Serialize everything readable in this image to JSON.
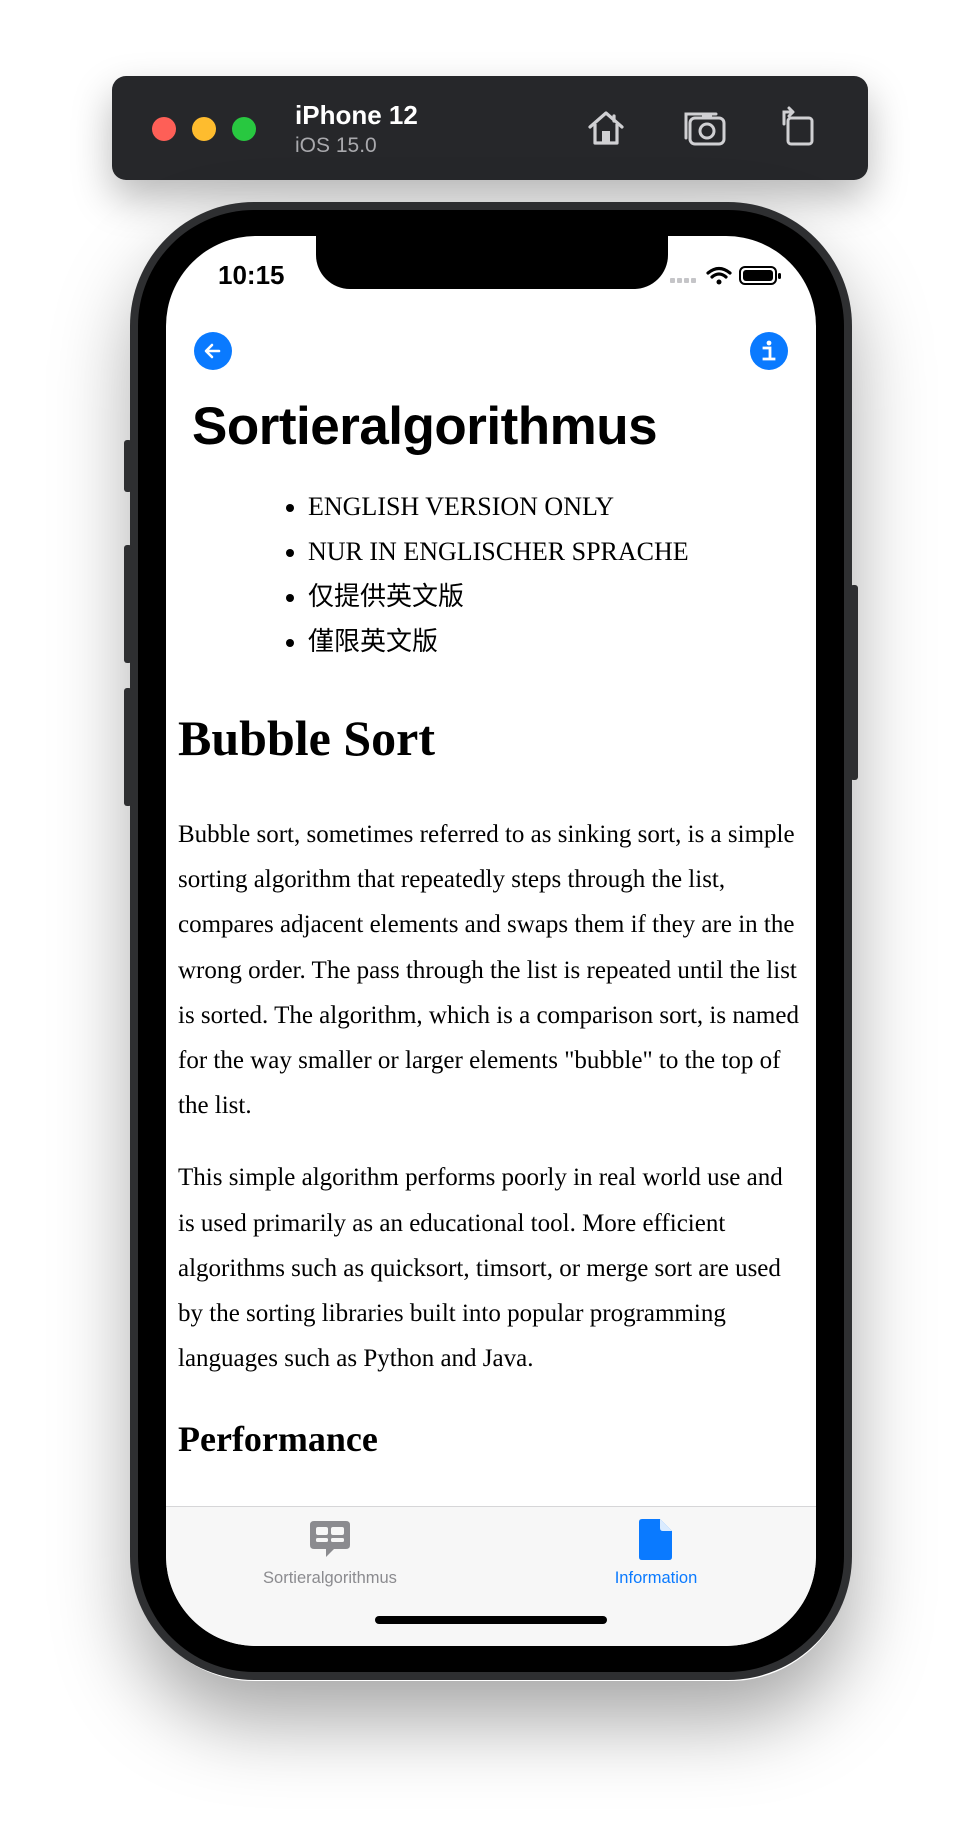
{
  "simulator": {
    "device_name": "iPhone 12",
    "os_version": "iOS 15.0",
    "buttons": [
      "home-icon",
      "screenshot-icon",
      "rotate-icon"
    ]
  },
  "status_bar": {
    "time": "10:15"
  },
  "nav": {
    "back_icon": "arrow-left-icon",
    "info_icon": "info-icon",
    "accent": "#0a7aff"
  },
  "page": {
    "title": "Sortieralgorithmus",
    "language_notes": [
      "ENGLISH VERSION ONLY",
      "NUR IN ENGLISCHER SPRACHE",
      "仅提供英文版",
      "僅限英文版"
    ],
    "heading": "Bubble Sort",
    "paragraphs": [
      "Bubble sort, sometimes referred to as sinking sort, is a simple sorting algorithm that repeatedly steps through the list, compares adjacent elements and swaps them if they are in the wrong order. The pass through the list is repeated until the list is sorted. The algorithm, which is a comparison sort, is named for the way smaller or larger elements \"bubble\" to the top of the list.",
      "This simple algorithm performs poorly in real world use and is used primarily as an educational tool. More efficient algorithms such as quicksort, timsort, or merge sort are used by the sorting libraries built into popular programming languages such as Python and Java."
    ],
    "subheading": "Performance"
  },
  "tabbar": {
    "tabs": [
      {
        "label": "Sortieralgorithmus",
        "icon": "chat-bubbles-icon",
        "active": false
      },
      {
        "label": "Information",
        "icon": "document-icon",
        "active": true
      }
    ],
    "active_color": "#0a7aff",
    "inactive_color": "#8b8b8f"
  }
}
